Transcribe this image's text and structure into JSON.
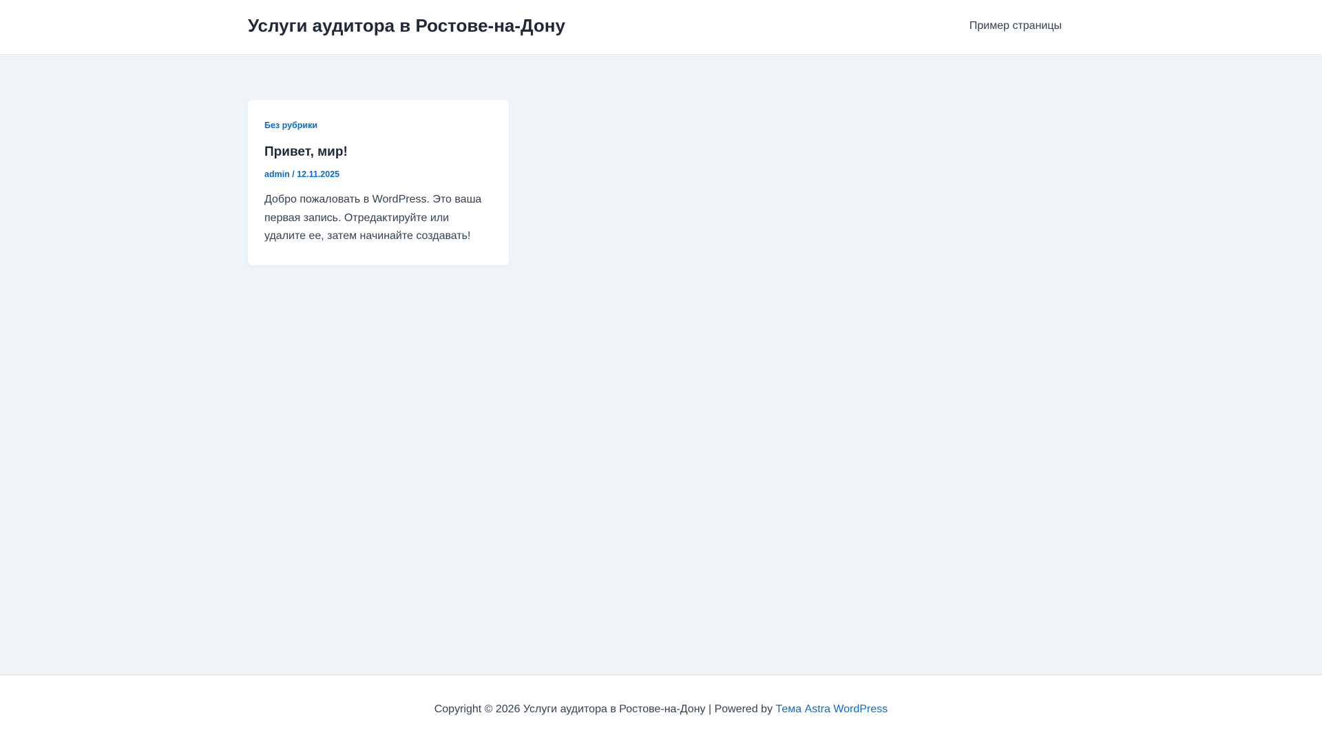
{
  "header": {
    "site_title": "Услуги аудитора в Ростове-на-Дону",
    "nav_items": [
      {
        "label": "Пример страницы"
      }
    ]
  },
  "post": {
    "category": "Без рубрики",
    "title": "Привет, мир!",
    "author": "admin",
    "meta_separator": " / ",
    "date": "12.11.2025",
    "excerpt": "Добро пожаловать в WordPress. Это ваша первая запись. Отредактируйте или удалите ее, затем начинайте создавать!"
  },
  "footer": {
    "copyright_text": "Copyright © 2026 Услуги аудитора в Ростове-на-Дону | Powered by ",
    "theme_link": "Тема Astra WordPress"
  },
  "colors": {
    "accent": "#0a6ccc",
    "heading": "#1e293b",
    "body_text": "#334155",
    "content_background": "#eff4f8",
    "card_background": "#ffffff"
  }
}
